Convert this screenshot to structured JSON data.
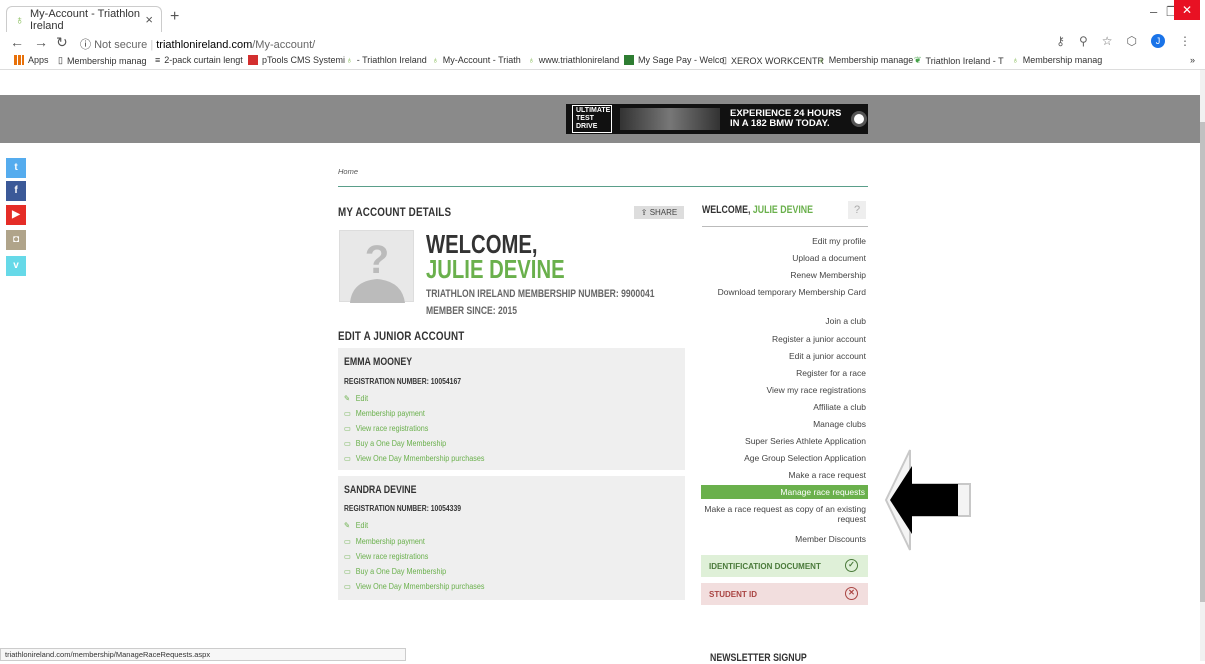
{
  "browser": {
    "tab_title": "My-Account - Triathlon Ireland",
    "tab_close": "×",
    "new_tab": "+",
    "url_not_secure": "Not secure",
    "url_domain": "triathlonireland.com",
    "url_path": "/My-account/",
    "profile_initial": "J",
    "bookmarks": [
      "Apps",
      "Membership manag",
      "2-pack curtain lengt",
      "pTools CMS Systemi",
      "- Triathlon Ireland",
      "My-Account - Triath",
      "www.triathlonireland",
      "My Sage Pay - Welco",
      "XEROX WORKCENTR",
      "Membership manage",
      "Triathlon Ireland - T",
      "Membership manag"
    ],
    "status_url": "triathlonireland.com/membership/ManageRaceRequests.aspx"
  },
  "ad": {
    "badge": "ULTIMATE TEST DRIVE",
    "line1": "EXPERIENCE 24 HOURS",
    "line2": "IN A 182 BMW TODAY."
  },
  "breadcrumb": "Home",
  "account": {
    "heading": "MY ACCOUNT DETAILS",
    "share": "SHARE",
    "welcome": "WELCOME,",
    "name": "JULIE DEVINE",
    "membership_number": "TRIATHLON IRELAND MEMBERSHIP NUMBER: 9900041",
    "member_since": "MEMBER SINCE: 2015"
  },
  "junior_heading": "EDIT A JUNIOR ACCOUNT",
  "juniors": [
    {
      "name": "EMMA MOONEY",
      "reg": "REGISTRATION NUMBER: 10054167",
      "links": [
        "Edit",
        "Membership payment",
        "View race registrations",
        "Buy a One Day Membership",
        "View One Day Mmembership purchases"
      ]
    },
    {
      "name": "SANDRA DEVINE",
      "reg": "REGISTRATION NUMBER: 10054339",
      "links": [
        "Edit",
        "Membership payment",
        "View race registrations",
        "Buy a One Day Membership",
        "View One Day Mmembership purchases"
      ]
    }
  ],
  "sidebar": {
    "welcome_prefix": "WELCOME,",
    "welcome_name": "JULIE DEVINE",
    "links": [
      "Edit my profile",
      "Upload a document",
      "Renew Membership",
      "Download temporary Membership Card",
      "Join a club",
      "Register a junior account",
      "Edit a junior account",
      "Register for a race",
      "View my race registrations",
      "Affiliate a club",
      "Manage clubs",
      "Super Series Athlete Application",
      "Age Group Selection Application",
      "Make a race request",
      "Manage race requests",
      "Make a race request as copy of an existing request",
      "Member Discounts"
    ],
    "active_index": 14,
    "id_document": "IDENTIFICATION DOCUMENT",
    "student_id": "STUDENT ID"
  },
  "newsletter": "NEWSLETTER SIGNUP",
  "colors": {
    "accent_green": "#6ab04c",
    "twitter": "#55acee",
    "facebook": "#3b5998",
    "youtube": "#e52d27",
    "instagram": "#b0a48a",
    "vimeo": "#66d9e8"
  }
}
